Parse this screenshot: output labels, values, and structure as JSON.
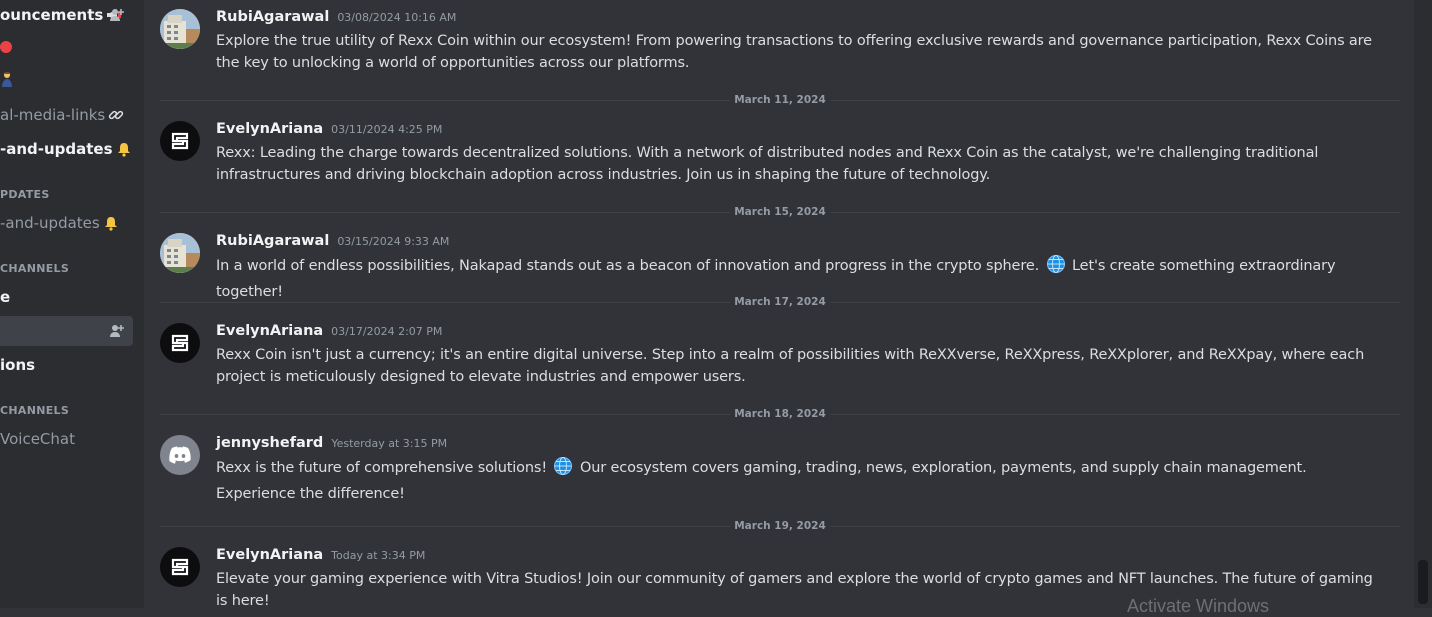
{
  "sidebar": {
    "channels": [
      {
        "label": "ouncements",
        "icon": "megaphone-icon",
        "unread": true,
        "has_add": true
      },
      {
        "label": "",
        "icon": "red-circle-icon",
        "unread": false,
        "has_add": false
      },
      {
        "label": "",
        "icon": "person-icon",
        "unread": false,
        "has_add": false
      },
      {
        "label": "al-media-links",
        "icon": "link-icon",
        "unread": false,
        "has_add": false
      },
      {
        "label": "-and-updates",
        "icon": "bell-icon",
        "unread": true,
        "has_add": false
      },
      {
        "label": "-and-updates",
        "icon": "bell-icon",
        "unread": false,
        "has_add": false
      },
      {
        "label": "e",
        "icon": "",
        "unread": true,
        "has_add": false
      },
      {
        "label": "",
        "icon": "",
        "unread": false,
        "selected": true,
        "has_add": true
      },
      {
        "label": "ions",
        "icon": "",
        "unread": true,
        "has_add": false
      },
      {
        "label": "VoiceChat",
        "icon": "",
        "unread": false,
        "has_add": false
      }
    ],
    "categories": [
      "PDATES",
      "CHANNELS",
      "CHANNELS"
    ]
  },
  "messages": [
    {
      "author": "RubiAgarawal",
      "timestamp": "03/08/2024 10:16 AM",
      "avatar": "photo-avatar",
      "text": "Explore the true utility of Rexx Coin within our ecosystem! From powering transactions to offering exclusive rewards and governance participation, Rexx Coins are the key to unlocking a world of opportunities across our platforms."
    },
    {
      "date_divider": "March 11, 2024",
      "author": "EvelynAriana",
      "timestamp": "03/11/2024 4:25 PM",
      "avatar": "rexx-logo-avatar",
      "text": "Rexx: Leading the charge towards decentralized solutions. With a network of distributed nodes and Rexx Coin as the catalyst, we're challenging traditional infrastructures and driving blockchain adoption across industries. Join us in shaping the future of technology."
    },
    {
      "date_divider": "March 15, 2024",
      "author": "RubiAgarawal",
      "timestamp": "03/15/2024 9:33 AM",
      "avatar": "photo-avatar",
      "text_before": "In a world of endless possibilities, Nakapad stands out as a beacon of innovation and progress in the crypto sphere.",
      "text_after": "Let's create something extraordinary together!"
    },
    {
      "date_divider": "March 17, 2024",
      "author": "EvelynAriana",
      "timestamp": "03/17/2024 2:07 PM",
      "avatar": "rexx-logo-avatar",
      "text": "Rexx Coin isn't just a currency; it's an entire digital universe. Step into a realm of possibilities with ReXXverse, ReXXpress, ReXXplorer, and ReXXpay, where each project is meticulously designed to elevate industries and empower users."
    },
    {
      "date_divider": "March 18, 2024",
      "author": "jennyshefard",
      "timestamp": "Yesterday at 3:15 PM",
      "avatar": "discord-default-avatar",
      "text_before": "Rexx is the future of comprehensive solutions!",
      "text_after": "Our ecosystem covers gaming, trading, news, exploration, payments, and supply chain management. Experience the difference!"
    },
    {
      "date_divider": "March 19, 2024",
      "author": "EvelynAriana",
      "timestamp": "Today at 3:34 PM",
      "avatar": "rexx-logo-avatar",
      "text": "Elevate your gaming experience with Vitra Studios! Join our community of gamers and explore the world of crypto games and NFT launches. The future of gaming is here!"
    }
  ],
  "watermark": "Activate Windows",
  "colors": {
    "background": "#313338",
    "sidebar": "#2b2d31",
    "text": "#dbdee1",
    "muted": "#949ba4"
  }
}
